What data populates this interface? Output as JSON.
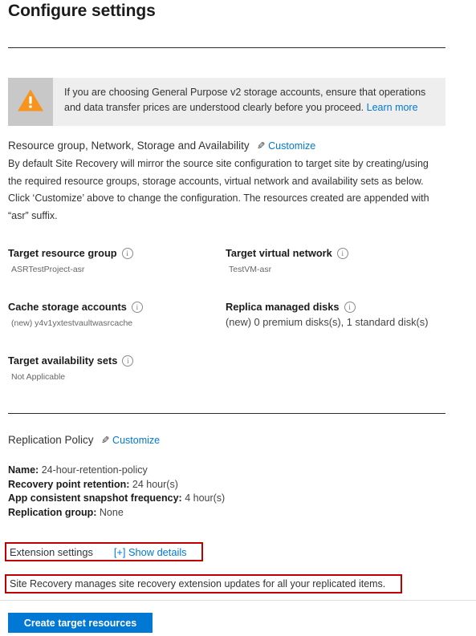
{
  "page": {
    "title": "Configure settings"
  },
  "warning": {
    "icon": "warning-triangle-icon",
    "text": "If you are choosing General Purpose v2 storage accounts, ensure that operations and data transfer prices are understood clearly before you proceed.",
    "link_label": "Learn more"
  },
  "resources_section": {
    "heading": "Resource group, Network, Storage and Availability",
    "customize_label": "Customize",
    "pencil_icon": "pencil-icon",
    "description": "By default Site Recovery will mirror the source site configuration to target site by creating/using the required resource groups, storage accounts, virtual network and availability sets as below. Click ‘Customize’ above to change the configuration. The resources created are appended with “asr” suffix.",
    "properties": [
      {
        "label": "Target resource group",
        "value": "ASRTestProject-asr",
        "info_icon": "info-icon"
      },
      {
        "label": "Target virtual network",
        "value": "TestVM-asr",
        "info_icon": "info-icon"
      },
      {
        "label": "Cache storage accounts",
        "value": "(new) y4v1yxtestvaultwasrcache",
        "info_icon": "info-icon"
      },
      {
        "label": "Replica managed disks",
        "value": "(new) 0 premium disks(s), 1 standard disk(s)",
        "info_icon": "info-icon"
      },
      {
        "label": "Target availability sets",
        "value": "Not Applicable",
        "info_icon": "info-icon"
      }
    ]
  },
  "replication_policy": {
    "heading": "Replication Policy",
    "customize_label": "Customize",
    "pencil_icon": "pencil-icon",
    "fields": [
      {
        "label": "Name:",
        "value": "24-hour-retention-policy"
      },
      {
        "label": "Recovery point retention:",
        "value": "24 hour(s)"
      },
      {
        "label": "App consistent snapshot frequency:",
        "value": "4 hour(s)"
      },
      {
        "label": "Replication group:",
        "value": "None"
      }
    ]
  },
  "extension_settings": {
    "label": "Extension settings",
    "show_details_label": "[+] Show details",
    "note": "Site Recovery manages site recovery extension updates for all your replicated items.",
    "highlight_color": "#c00000"
  },
  "footer": {
    "create_button_label": "Create target resources",
    "accent_color": "#0078d4"
  }
}
